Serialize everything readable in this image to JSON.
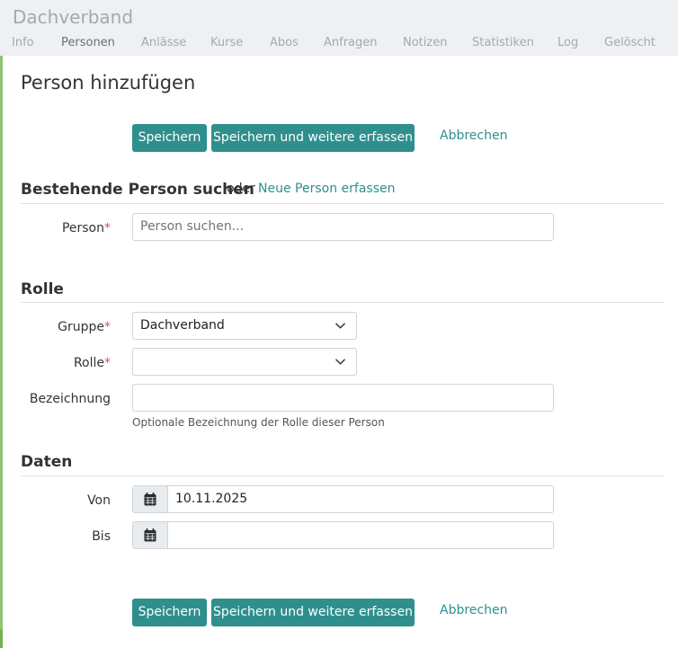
{
  "header": {
    "org_name": "Dachverband",
    "tabs": [
      {
        "label": "Info"
      },
      {
        "label": "Personen",
        "active": true
      },
      {
        "label": "Anlässe"
      },
      {
        "label": "Kurse"
      },
      {
        "label": "Abos"
      },
      {
        "label": "Anfragen"
      },
      {
        "label": "Notizen"
      },
      {
        "label": "Statistiken"
      },
      {
        "label": "Log"
      },
      {
        "label": "Gelöscht"
      }
    ]
  },
  "page": {
    "title": "Person hinzufügen"
  },
  "actions": {
    "save": "Speichern",
    "save_and_new": "Speichern und weitere erfassen",
    "cancel": "Abbrechen"
  },
  "search_section": {
    "title": "Bestehende Person suchen",
    "or_text": "oder",
    "new_person_link": "Neue Person erfassen",
    "person_label": "Person",
    "person_placeholder": "Person suchen..."
  },
  "role_section": {
    "title": "Rolle",
    "group_label": "Gruppe",
    "group_value": "Dachverband",
    "role_label": "Rolle",
    "role_value": "",
    "designation_label": "Bezeichnung",
    "designation_value": "",
    "designation_help": "Optionale Bezeichnung der Rolle dieser Person"
  },
  "dates_section": {
    "title": "Daten",
    "from_label": "Von",
    "from_value": "10.11.2025",
    "to_label": "Bis",
    "to_value": ""
  },
  "colors": {
    "primary": "#2f8f8d",
    "required": "#d9534f",
    "accent_edge": "#8fc473"
  }
}
